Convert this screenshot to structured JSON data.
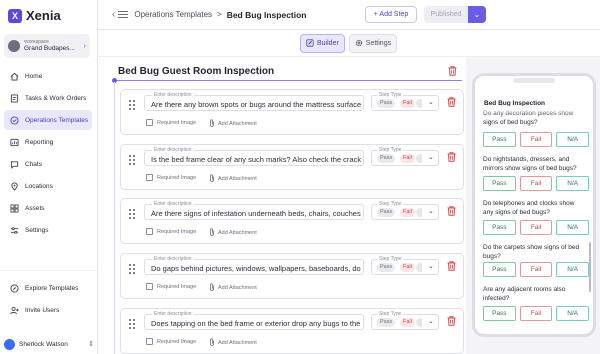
{
  "app": {
    "logo_mark": "X",
    "logo_text": "Xenia"
  },
  "workspace": {
    "label": "Workspace",
    "name": "Grand Budapes..."
  },
  "nav": [
    {
      "label": "Home",
      "icon": "home-icon"
    },
    {
      "label": "Tasks & Work Orders",
      "icon": "tasks-icon"
    },
    {
      "label": "Operations Templates",
      "icon": "templates-icon",
      "active": true
    },
    {
      "label": "Reporting",
      "icon": "reporting-icon"
    },
    {
      "label": "Chats",
      "icon": "chat-icon"
    },
    {
      "label": "Locations",
      "icon": "location-icon"
    },
    {
      "label": "Assets",
      "icon": "assets-icon"
    },
    {
      "label": "Settings",
      "icon": "settings-icon"
    }
  ],
  "nav_bottom": [
    {
      "label": "Explore Templates",
      "icon": "explore-icon"
    },
    {
      "label": "Invite Users",
      "icon": "invite-icon"
    }
  ],
  "user": {
    "name": "Sherlock Watson",
    "initial": "S"
  },
  "header": {
    "crumb_parent": "Operations Templates",
    "crumb_separator": ">",
    "crumb_current": "Bed Bug Inspection",
    "add_step": "+ Add Step",
    "published": "Published"
  },
  "tabs": {
    "builder": "Builder",
    "settings": "Settings"
  },
  "builder": {
    "title": "Bed Bug Guest Room Inspection",
    "desc_label": "Enter description",
    "step_type_label": "Step Type",
    "chip_pass": "Pass",
    "chip_fail": "Fail",
    "required_image": "Required Image",
    "add_attachment": "Add Attachment",
    "steps": [
      "Are there any brown spots or bugs around the mattress surface",
      "Is the bed frame clear of any such marks? Also check the cracks",
      "Are there signs of infestation underneath beds, chairs, couches",
      "Do gaps behind pictures, windows, wallpapers, baseboards, door",
      "Does tapping on the bed frame or exterior drop any bugs to the"
    ]
  },
  "preview": {
    "title": "Bed Bug Inspection",
    "pass": "Pass",
    "fail": "Fail",
    "na": "N/A",
    "questions": [
      "Do any decoration pieces show signs of bed bugs?",
      "Do nightstands, dressers, and mirrors show signs of bed bugs?",
      "Do telephones and clocks show any signs of bed bugs?",
      "Do the carpets show signs of bed bugs?",
      "Are any adjacent rooms also infected?"
    ]
  },
  "colors": {
    "accent": "#6a5ce6",
    "danger": "#d04848",
    "pass": "#2d7a50"
  }
}
